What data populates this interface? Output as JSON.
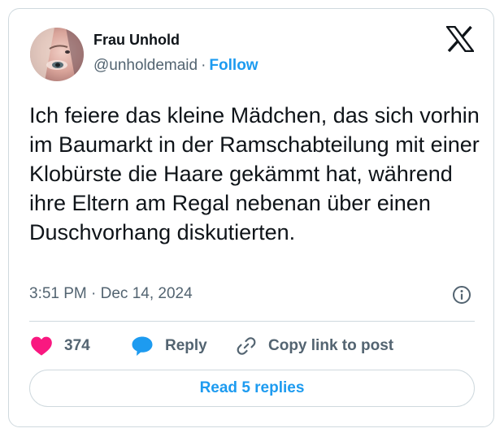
{
  "author": {
    "display_name": "Frau Unhold",
    "handle": "@unholdemaid",
    "separator": "·",
    "follow_label": "Follow"
  },
  "tweet": {
    "text": "Ich feiere das kleine Mädchen, das sich vorhin im Baumarkt in der Ramschabteilung mit einer Klobürste die Haare gekämmt hat, während ihre Eltern am Regal nebenan über einen Duschvorhang diskutierten.",
    "timestamp": "3:51 PM · Dec 14, 2024"
  },
  "actions": {
    "like_count": "374",
    "reply_label": "Reply",
    "copy_link_label": "Copy link to post"
  },
  "footer": {
    "read_replies_label": "Read 5 replies"
  },
  "icons": {
    "brand": "x-logo-icon",
    "info": "info-icon",
    "like": "heart-icon",
    "reply": "speech-bubble-icon",
    "copy": "link-icon"
  },
  "colors": {
    "accent": "#1d9bf0",
    "like": "#f91880",
    "text": "#0f1419",
    "secondary": "#536471",
    "border": "#cfd9de"
  }
}
